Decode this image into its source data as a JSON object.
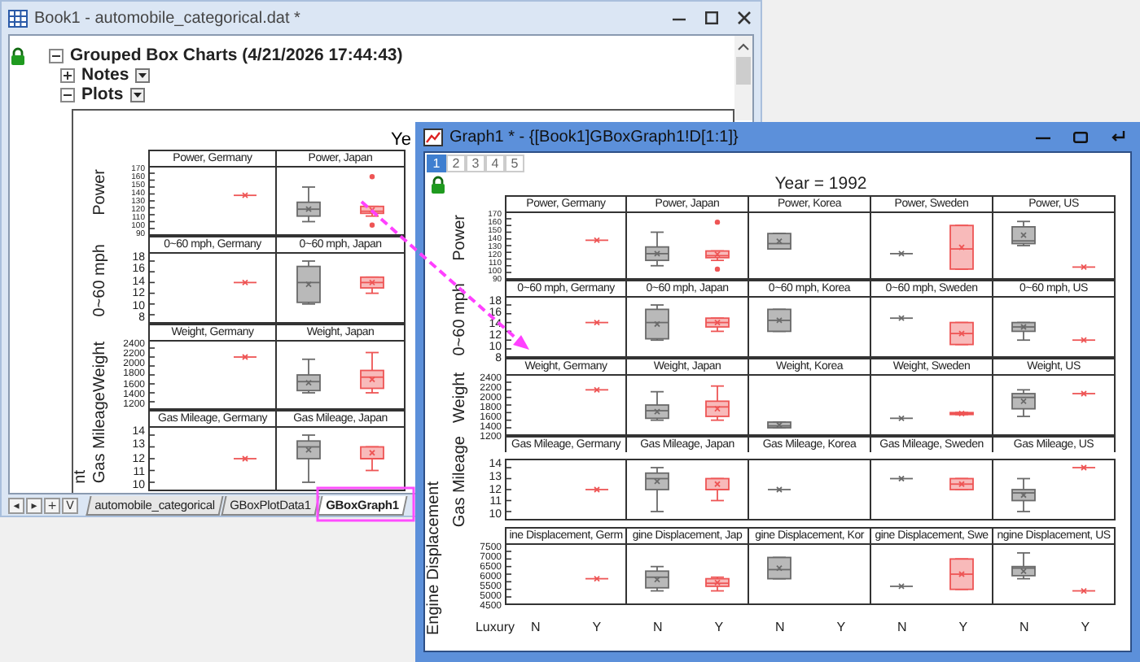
{
  "book_window": {
    "title": "Book1 - automobile_categorical.dat *"
  },
  "tree": {
    "label": "Grouped Box Charts (4/21/2026 17:44:43)",
    "expanded": true,
    "children": [
      {
        "label": "Notes",
        "expanded": false
      },
      {
        "label": "Plots",
        "expanded": true
      }
    ]
  },
  "book_graph": {
    "title": "Ye",
    "cut_axis_title": "nt",
    "rows": [
      {
        "axis_title": "Power",
        "ticks": [
          "170",
          "160",
          "150",
          "140",
          "130",
          "120",
          "110",
          "100",
          "90"
        ],
        "panels": [
          "Power, Germany",
          "Power, Japan"
        ]
      },
      {
        "axis_title": "0~60 mph",
        "ticks": [
          "18",
          "16",
          "14",
          "12",
          "10",
          "8"
        ],
        "panels": [
          "0~60 mph, Germany",
          "0~60 mph, Japan"
        ]
      },
      {
        "axis_title": "Weight",
        "ticks": [
          "2400",
          "2200",
          "2000",
          "1800",
          "1600",
          "1400",
          "1200"
        ],
        "panels": [
          "Weight, Germany",
          "Weight, Japan"
        ]
      },
      {
        "axis_title": "Gas Mileage",
        "ticks": [
          "14",
          "13",
          "12",
          "11",
          "10"
        ],
        "panels": [
          "Gas Mileage, Germany",
          "Gas Mileage, Japan"
        ]
      }
    ]
  },
  "sheet_nav": [
    "◂",
    "▸",
    "+",
    "V"
  ],
  "sheet_tabs": [
    {
      "label": "automobile_categorical",
      "selected": false
    },
    {
      "label": "GBoxPlotData1",
      "selected": false
    },
    {
      "label": "GBoxGraph1",
      "selected": true
    }
  ],
  "graph_window": {
    "title": "Graph1 * - {[Book1]GBoxGraph1!D[1:1]}"
  },
  "page_tabs": [
    {
      "label": "1",
      "selected": true
    },
    {
      "label": "2",
      "selected": false
    },
    {
      "label": "3",
      "selected": false
    },
    {
      "label": "4",
      "selected": false
    },
    {
      "label": "5",
      "selected": false
    }
  ],
  "graph": {
    "title": "Year = 1992",
    "rows": [
      {
        "axis_title": "Power",
        "ticks": [
          "170",
          "160",
          "150",
          "140",
          "130",
          "120",
          "110",
          "100",
          "90"
        ],
        "panels": [
          "Power, Germany",
          "Power, Japan",
          "Power, Korea",
          "Power, Sweden",
          "Power, US"
        ]
      },
      {
        "axis_title": "0~60 mph",
        "ticks": [
          "18",
          "16",
          "14",
          "12",
          "10",
          "8"
        ],
        "panels": [
          "0~60 mph, Germany",
          "0~60 mph, Japan",
          "0~60 mph, Korea",
          "0~60 mph, Sweden",
          "0~60 mph, US"
        ]
      },
      {
        "axis_title": "Weight",
        "ticks": [
          "2400",
          "2200",
          "2000",
          "1800",
          "1600",
          "1400",
          "1200"
        ],
        "panels": [
          "Weight, Germany",
          "Weight, Japan",
          "Weight, Korea",
          "Weight, Sweden",
          "Weight, US"
        ]
      },
      {
        "axis_title": "Gas Mileage",
        "ticks": [
          "14",
          "13",
          "12",
          "11",
          "10"
        ],
        "panels": [
          "Gas Mileage, Germany",
          "Gas Mileage, Japan",
          "Gas Mileage, Korea",
          "Gas Mileage, Sweden",
          "Gas Mileage, US"
        ]
      },
      {
        "axis_title": "Engine Displacement",
        "ticks": [
          "7500",
          "7000",
          "6500",
          "6000",
          "5500",
          "5000",
          "4500"
        ],
        "panels": [
          "ine Displacement, Germ",
          "gine Displacement, Jap",
          "gine Displacement, Kor",
          "gine Displacement, Swe",
          "ngine Displacement, US"
        ]
      }
    ],
    "x_axis": {
      "title": "Luxury",
      "labels": [
        "N",
        "Y",
        "N",
        "Y",
        "N",
        "Y",
        "N",
        "Y",
        "N",
        "Y"
      ]
    }
  }
}
